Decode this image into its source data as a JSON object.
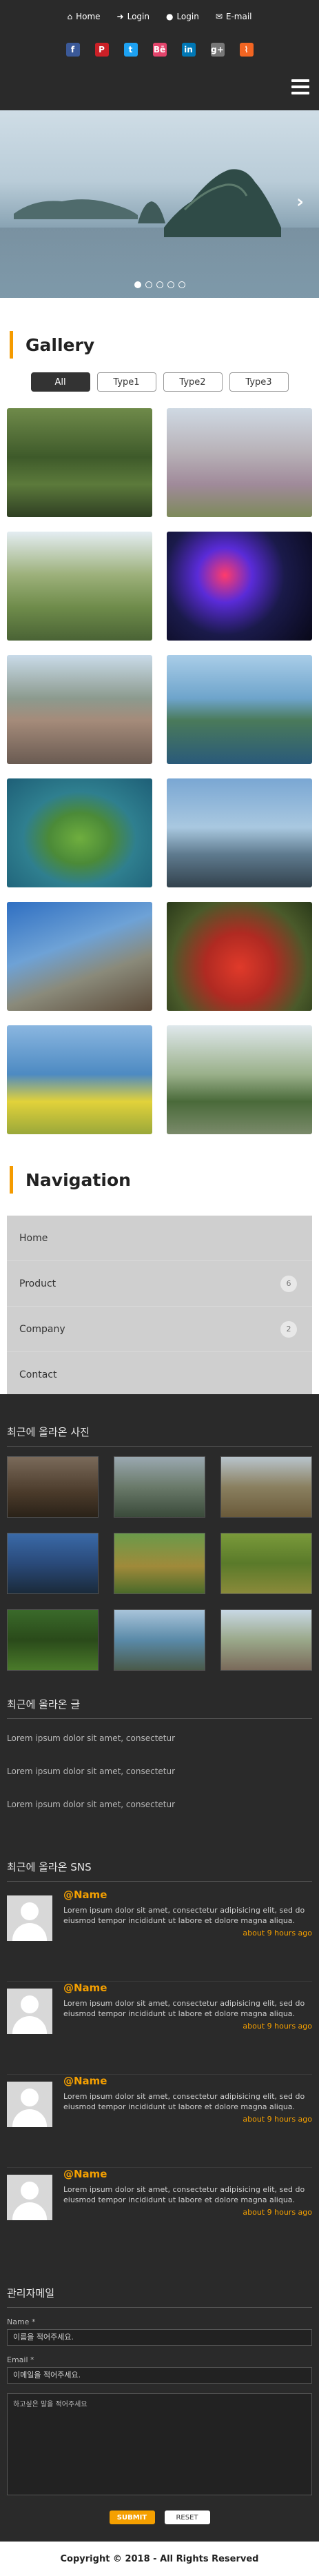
{
  "top_links": [
    {
      "icon": "home-icon",
      "glyph": "⌂",
      "label": "Home"
    },
    {
      "icon": "sign-in-icon",
      "glyph": "➜",
      "label": "Login"
    },
    {
      "icon": "user-icon",
      "glyph": "●",
      "label": "Login"
    },
    {
      "icon": "envelope-icon",
      "glyph": "✉",
      "label": "E-mail"
    }
  ],
  "social": [
    {
      "name": "facebook-icon",
      "glyph": "f",
      "color": "#3b5998"
    },
    {
      "name": "pinterest-icon",
      "glyph": "P",
      "color": "#cb2027"
    },
    {
      "name": "twitter-icon",
      "glyph": "t",
      "color": "#1da1f2"
    },
    {
      "name": "behance-icon",
      "glyph": "Bē",
      "color": "#e3446b"
    },
    {
      "name": "linkedin-icon",
      "glyph": "in",
      "color": "#0077b5"
    },
    {
      "name": "google-plus-icon",
      "glyph": "g+",
      "color": "#777777"
    },
    {
      "name": "rss-icon",
      "glyph": "⌇",
      "color": "#f26522"
    }
  ],
  "slider": {
    "dots": 5,
    "active_dot": 0
  },
  "gallery": {
    "title": "Gallery",
    "filters": [
      "All",
      "Type1",
      "Type2",
      "Type3"
    ],
    "active_filter": "All"
  },
  "navigation": {
    "title": "Navigation",
    "items": [
      {
        "label": "Home",
        "badge": ""
      },
      {
        "label": "Product",
        "badge": "6"
      },
      {
        "label": "Company",
        "badge": "2"
      },
      {
        "label": "Contact",
        "badge": ""
      }
    ]
  },
  "recent_photos": {
    "title": "최근에 올라온 사진"
  },
  "recent_posts": {
    "title": "최근에 올라온 글",
    "items": [
      "Lorem ipsum dolor sit amet, consectetur",
      "Lorem ipsum dolor sit amet, consectetur",
      "Lorem ipsum dolor sit amet, consectetur"
    ]
  },
  "recent_sns": {
    "title": "최근에 올라온 SNS",
    "items": [
      {
        "name": "@Name",
        "text": "Lorem ipsum dolor sit amet, consectetur adipisicing elit, sed do eiusmod tempor incididunt ut labore et dolore magna aliqua.",
        "time": "about 9 hours ago"
      },
      {
        "name": "@Name",
        "text": "Lorem ipsum dolor sit amet, consectetur adipisicing elit, sed do eiusmod tempor incididunt ut labore et dolore magna aliqua.",
        "time": "about 9 hours ago"
      },
      {
        "name": "@Name",
        "text": "Lorem ipsum dolor sit amet, consectetur adipisicing elit, sed do eiusmod tempor incididunt ut labore et dolore magna aliqua.",
        "time": "about 9 hours ago"
      },
      {
        "name": "@Name",
        "text": "Lorem ipsum dolor sit amet, consectetur adipisicing elit, sed do eiusmod tempor incididunt ut labore et dolore magna aliqua.",
        "time": "about 9 hours ago"
      }
    ]
  },
  "contact_form": {
    "title": "관리자메일",
    "name_label": "Name *",
    "name_placeholder": "이름을 적어주세요.",
    "email_label": "Email *",
    "email_placeholder": "이메일을 적어주세요.",
    "message_placeholder": "하고싶은 말을 적어주세요",
    "submit_label": "SUBMIT",
    "reset_label": "RESET"
  },
  "footer": {
    "text": "Copyright © 2018 - All Rights Reserved"
  },
  "colors": {
    "accent": "#f59b00",
    "dark_bg": "#2a2a2a"
  }
}
